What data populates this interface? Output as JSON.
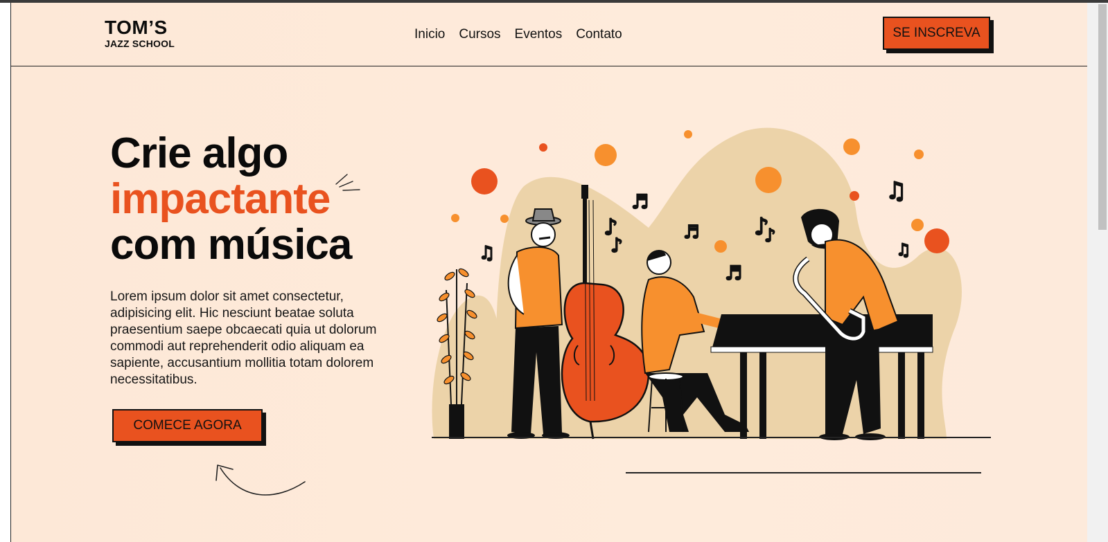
{
  "logo": {
    "main": "TOM’S",
    "sub": "JAZZ SCHOOL"
  },
  "nav": {
    "items": [
      {
        "label": "Inicio"
      },
      {
        "label": "Cursos"
      },
      {
        "label": "Eventos"
      },
      {
        "label": "Contato"
      }
    ]
  },
  "header": {
    "signup_label": "SE INSCREVA"
  },
  "hero": {
    "title_line1": "Crie algo",
    "title_line2": "impactante",
    "title_line3": "com música",
    "paragraph": "Lorem ipsum dolor sit amet consectetur, adipisicing elit. Hic nesciunt beatae soluta praesentium saepe obcaecati quia ut dolorum commodi aut reprehenderit odio aliquam ea sapiente, accusantium mollitia totam dolorem necessitatibus.",
    "cta_label": "COMECE AGORA"
  },
  "colors": {
    "background": "#feebdb",
    "accent": "#e9521f",
    "orange": "#f7902e",
    "beige": "#ecd3a9",
    "text": "#0a0a0a"
  },
  "icons": [
    "sparkle-icon",
    "curved-arrow-icon",
    "music-note-icon"
  ]
}
